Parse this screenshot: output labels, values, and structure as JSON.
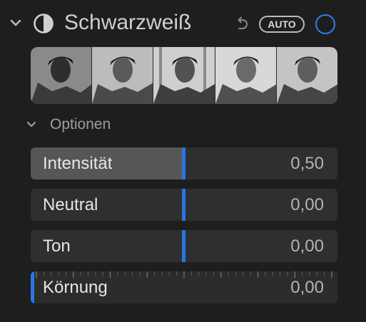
{
  "header": {
    "title": "Schwarzweiß",
    "auto_label": "AUTO",
    "icons": [
      "chevron-down-icon",
      "black-white-icon",
      "undo-icon",
      "enable-toggle-icon"
    ],
    "accent_color": "#2b74e6"
  },
  "presets": {
    "count": 5
  },
  "options": {
    "label": "Optionen"
  },
  "sliders": [
    {
      "label": "Intensität",
      "value": "0,50",
      "level": 0.5
    },
    {
      "label": "Neutral",
      "value": "0,00",
      "level": 0.5
    },
    {
      "label": "Ton",
      "value": "0,00",
      "level": 0.5
    },
    {
      "label": "Körnung",
      "value": "0,00",
      "level": 0.0
    }
  ]
}
